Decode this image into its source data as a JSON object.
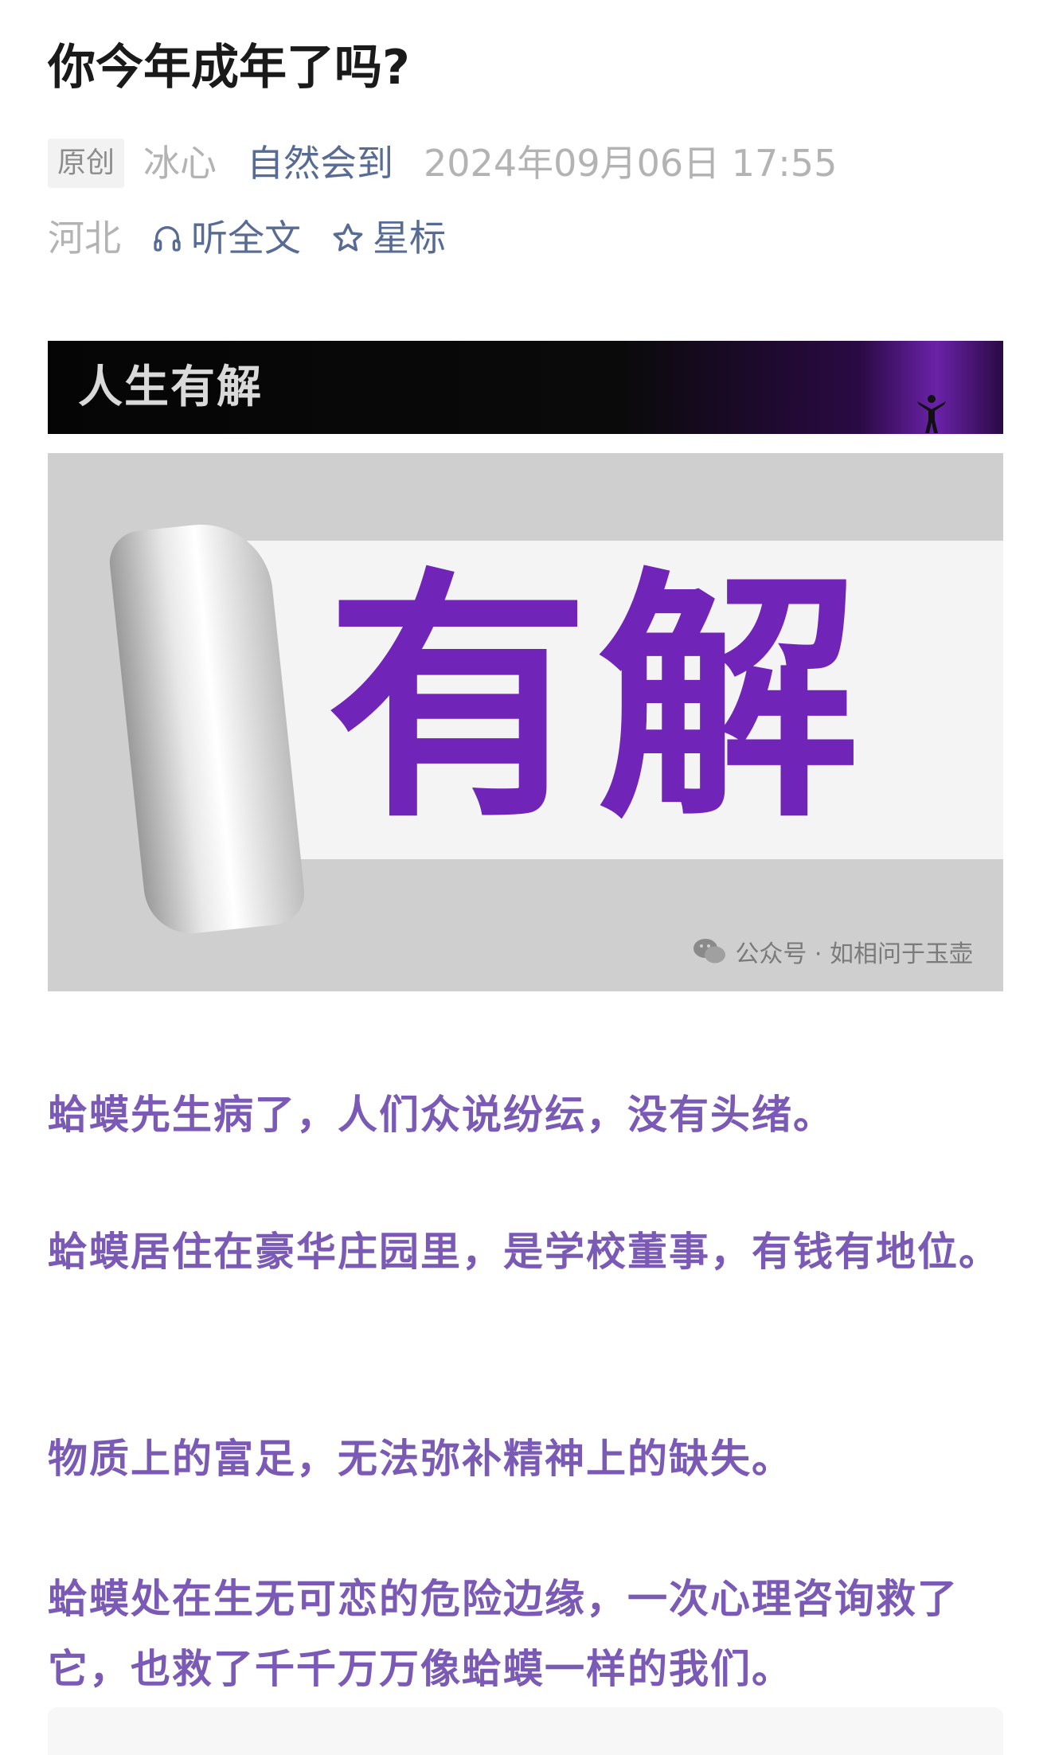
{
  "article": {
    "title": "你今年成年了吗?",
    "badge": "原创",
    "author": "冰心",
    "account": "自然会到",
    "datetime": "2024年09月06日 17:55",
    "location": "河北",
    "listen_label": "听全文",
    "star_label": "星标"
  },
  "banner": {
    "text": "人生有解"
  },
  "hero": {
    "text": "有解",
    "watermark": "公众号 · 如相问于玉壶"
  },
  "paragraphs": [
    "蛤蟆先生病了，人们众说纷纭，没有头绪。",
    "蛤蟆居住在豪华庄园里，是学校董事，有钱有地位。",
    "物质上的富足，无法弥补精神上的缺失。",
    "蛤蟆处在生无可恋的危险边缘，一次心理咨询救了它，也救了千千万万像蛤蟆一样的我们。"
  ],
  "colors": {
    "accent_text": "#7a5ab5",
    "link_blue": "#576b95",
    "hero_purple": "#7024b8"
  }
}
